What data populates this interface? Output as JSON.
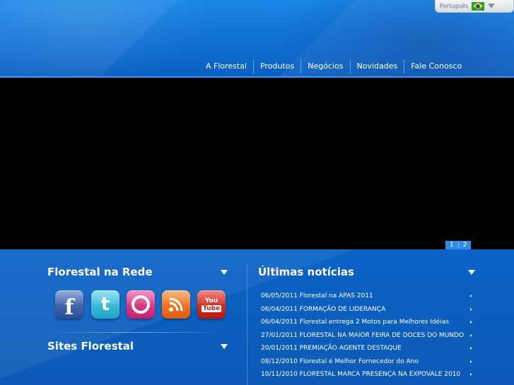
{
  "language": {
    "label": "Português"
  },
  "nav": [
    {
      "label": "A Florestal"
    },
    {
      "label": "Produtos"
    },
    {
      "label": "Negócios"
    },
    {
      "label": "Novidades"
    },
    {
      "label": "Fale Conosco"
    }
  ],
  "slider": {
    "pages": [
      "1",
      "2"
    ]
  },
  "social_panel": {
    "title": "Florestal na Rede"
  },
  "sites_panel": {
    "title": "Sites Florestal"
  },
  "news_panel": {
    "title": "Últimas notícias",
    "items": [
      {
        "text": "06/05/2011 Florestal na APAS 2011"
      },
      {
        "text": "06/04/2011 FORMAÇÃO DE LIDERANÇA"
      },
      {
        "text": "06/04/2011 Florestal entrega 2 Motos para Melhores Idéias"
      },
      {
        "text": "27/01/2011 FLORESTAL NA MAIOR FEIRA DE DOCES DO MUNDO"
      },
      {
        "text": "20/01/2011 PREMIAÇÃO AGENTE DESTAQUE"
      },
      {
        "text": "08/12/2010 Florestal é Melhor Fornecedor do Ano"
      },
      {
        "text": "10/11/2010 FLORESTAL MARCA PRESENÇA NA EXPOVALE 2010"
      },
      {
        "text": ""
      }
    ]
  },
  "icons": {
    "facebook": {
      "glyph": "f"
    },
    "twitter": {
      "glyph": "t"
    },
    "youtube": {
      "top": "You",
      "bottom": "Tube"
    }
  }
}
